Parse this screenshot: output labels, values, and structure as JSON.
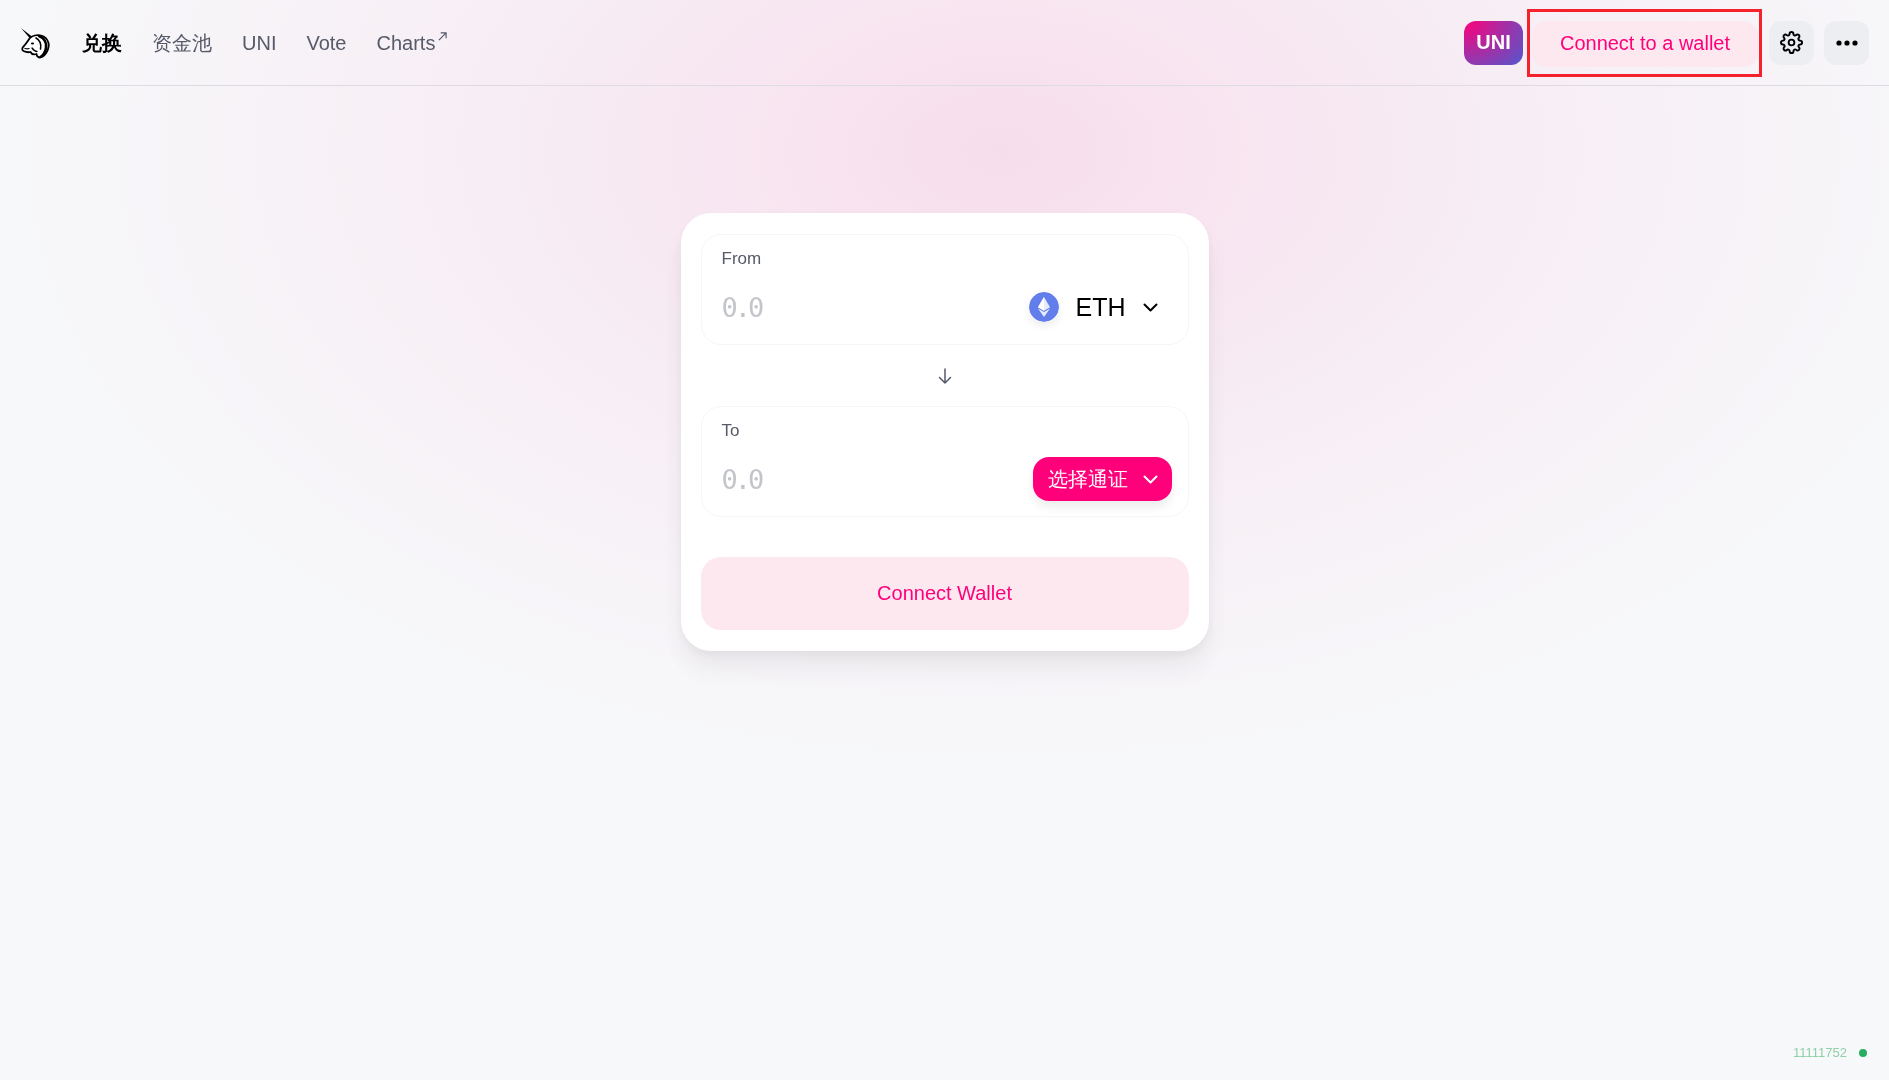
{
  "header": {
    "nav": [
      {
        "label": "兑换",
        "selected": true,
        "external": false
      },
      {
        "label": "资金池",
        "selected": false,
        "external": false
      },
      {
        "label": "UNI",
        "selected": false,
        "external": false
      },
      {
        "label": "Vote",
        "selected": false,
        "external": false
      },
      {
        "label": "Charts",
        "selected": false,
        "external": true
      }
    ],
    "uni_badge": "UNI",
    "wallet_button": {
      "label": "Connect to a wallet",
      "highlighted": true
    }
  },
  "swap": {
    "panels": [
      {
        "label": "From",
        "placeholder": "0.0",
        "token": {
          "kind": "chosen",
          "text": "ETH"
        }
      },
      {
        "label": "To",
        "placeholder": "0.0",
        "token": {
          "kind": "prompt",
          "text": "选择通证"
        }
      }
    ],
    "submit_button": "Connect Wallet"
  },
  "footer": {
    "block_number": "11111752"
  }
}
